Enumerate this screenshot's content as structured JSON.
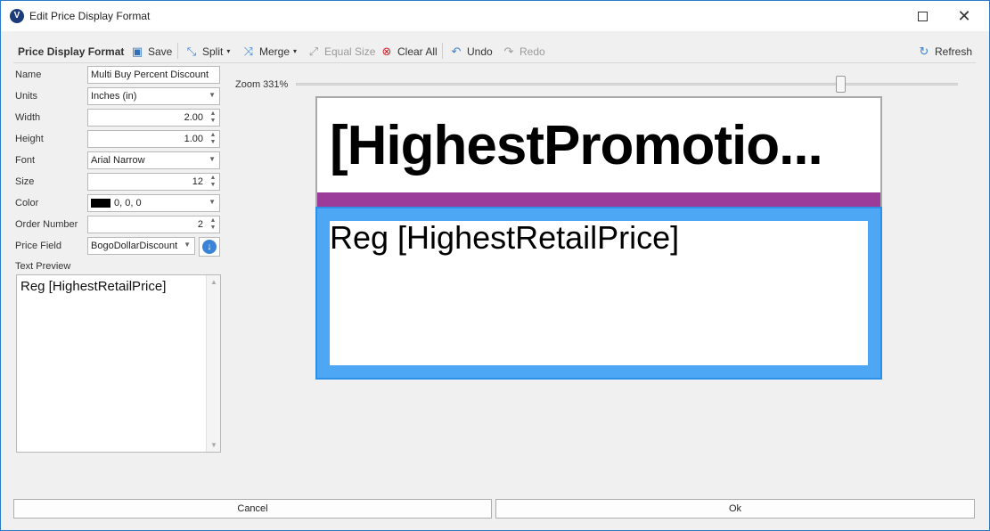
{
  "window": {
    "title": "Edit Price Display Format",
    "app_icon": "app-logo-icon"
  },
  "toolbar": {
    "title": "Price Display Format",
    "save": "Save",
    "split": "Split",
    "merge": "Merge",
    "equal_size": "Equal Size",
    "clear_all": "Clear All",
    "undo": "Undo",
    "redo": "Redo",
    "refresh": "Refresh"
  },
  "properties": {
    "name_label": "Name",
    "name_value": "Multi Buy Percent Discount",
    "units_label": "Units",
    "units_value": "Inches (in)",
    "width_label": "Width",
    "width_value": "2.00",
    "height_label": "Height",
    "height_value": "1.00",
    "font_label": "Font",
    "font_value": "Arial Narrow",
    "size_label": "Size",
    "size_value": "12",
    "color_label": "Color",
    "color_value": "0, 0, 0",
    "color_swatch": "#000000",
    "order_label": "Order Number",
    "order_value": "2",
    "price_field_label": "Price Field",
    "price_field_value": "BogoDollarDiscount",
    "text_preview_label": "Text Preview",
    "text_preview_value": "Reg  [HighestRetailPrice]"
  },
  "zoom": {
    "label": "Zoom 331%",
    "level_percent": 331
  },
  "canvas": {
    "section1_text": "[HighestPromotio...",
    "section2_text": "Reg  [HighestRetailPrice]",
    "band_color": "#9b3c9a",
    "selected_color": "#4ea7f5"
  },
  "footer": {
    "cancel": "Cancel",
    "ok": "Ok"
  }
}
